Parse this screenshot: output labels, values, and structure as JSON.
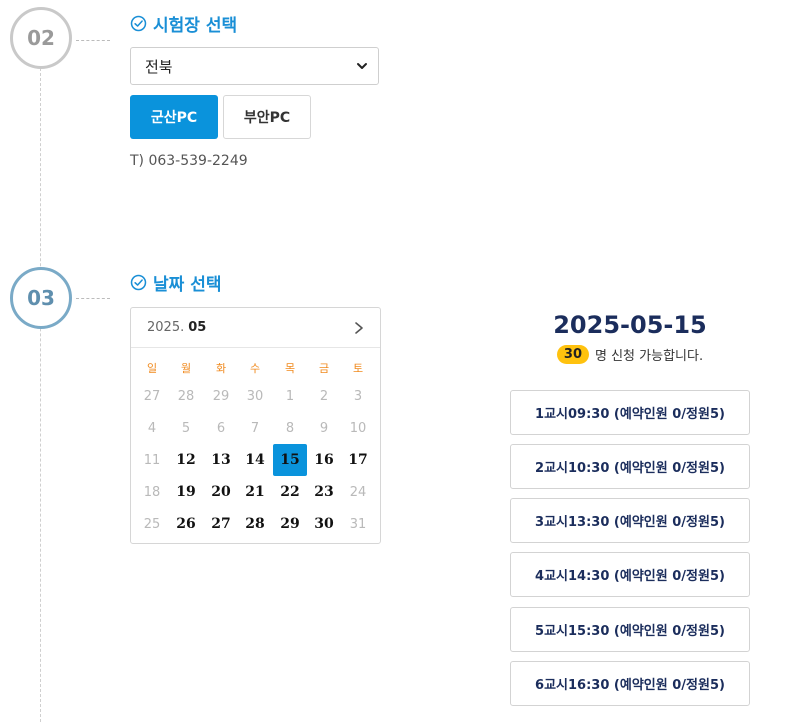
{
  "steps": [
    {
      "number": "02",
      "title": "시험장 선택"
    },
    {
      "number": "03",
      "title": "날짜 선택"
    }
  ],
  "exam_site": {
    "region_selected": "전북",
    "branches": [
      {
        "label": "군산PC",
        "selected": true
      },
      {
        "label": "부안PC",
        "selected": false
      }
    ],
    "phone": "T) 063-539-2249"
  },
  "calendar": {
    "year": "2025.",
    "month": "05",
    "weekdays": [
      "일",
      "월",
      "화",
      "수",
      "목",
      "금",
      "토"
    ],
    "weeks": [
      [
        "27",
        "28",
        "29",
        "30",
        "1",
        "2",
        "3"
      ],
      [
        "4",
        "5",
        "6",
        "7",
        "8",
        "9",
        "10"
      ],
      [
        "11",
        "12",
        "13",
        "14",
        "15",
        "16",
        "17"
      ],
      [
        "18",
        "19",
        "20",
        "21",
        "22",
        "23",
        "24"
      ],
      [
        "25",
        "26",
        "27",
        "28",
        "29",
        "30",
        "31"
      ]
    ],
    "available_days": [
      "12",
      "13",
      "14",
      "15",
      "16",
      "17",
      "19",
      "20",
      "21",
      "22",
      "23",
      "26",
      "27",
      "28",
      "29",
      "30"
    ],
    "selected_day": "15"
  },
  "selected_date": {
    "date": "2025-05-15",
    "count": "30",
    "count_suffix": "명 신청 가능합니다."
  },
  "time_slots": [
    "1교시09:30 (예약인원 0/정원5)",
    "2교시10:30 (예약인원 0/정원5)",
    "3교시13:30 (예약인원 0/정원5)",
    "4교시14:30 (예약인원 0/정원5)",
    "5교시15:30 (예약인원 0/정원5)",
    "6교시16:30 (예약인원 0/정원5)"
  ],
  "colors": {
    "accent": "#0a93dc",
    "title_blue": "#1a8fd6",
    "navy": "#1b2d5c",
    "badge": "#ffc20e",
    "weekday_orange": "#f08a1e"
  }
}
